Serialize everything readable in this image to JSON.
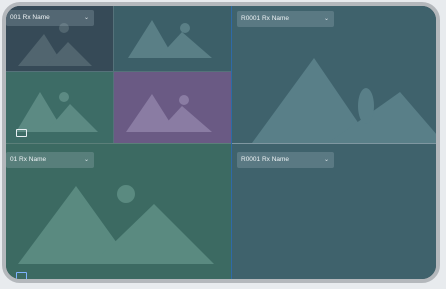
{
  "panes": {
    "p1": {
      "dropdown": "001 Rx Name",
      "chevron": "⌄"
    },
    "p3": {
      "dropdown": "R0001 Rx Name",
      "chevron": "⌄"
    },
    "p6": {
      "dropdown": "01 Rx Name",
      "chevron": "⌄"
    },
    "p7": {
      "dropdown": "R0001 Rx Name",
      "chevron": "⌄"
    }
  },
  "colors": {
    "pane_dark": "#364a57",
    "pane_teal": "#3c5f68",
    "pane_green": "#3d6c66",
    "pane_purple": "#6a5a84",
    "pane_right": "#3f626c",
    "pane_bottom_left": "#3c6a62",
    "selected_border": "#2e6aa8"
  }
}
